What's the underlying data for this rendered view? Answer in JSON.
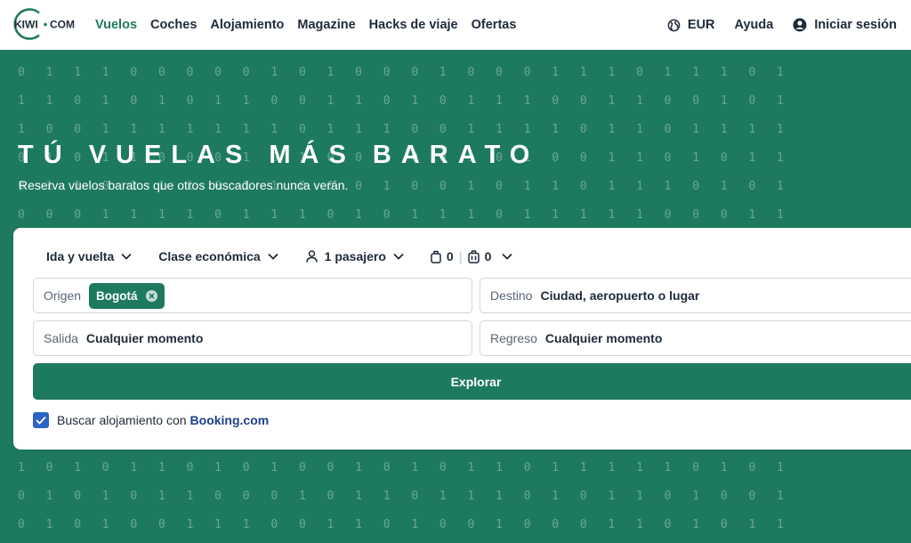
{
  "brand": {
    "logo_text_left": "KIWI",
    "logo_text_right": "COM",
    "accent": "#1e7a5f"
  },
  "nav": {
    "links": [
      {
        "label": "Vuelos",
        "active": true
      },
      {
        "label": "Coches",
        "active": false
      },
      {
        "label": "Alojamiento",
        "active": false
      },
      {
        "label": "Magazine",
        "active": false
      },
      {
        "label": "Hacks de viaje",
        "active": false
      },
      {
        "label": "Ofertas",
        "active": false
      }
    ],
    "currency": "EUR",
    "help": "Ayuda",
    "login": "Iniciar sesión"
  },
  "hero": {
    "title": "TÚ VUELAS MÁS BARATO",
    "subtitle": "Reserva vuelos baratos que otros buscadores nunca verán.",
    "binary_rows": [
      "0111000001010001000111011101",
      "1101010110011010111001100101",
      "1001111111011100111101101111",
      "0101100010100100101001101011",
      "0110111011000100101101110101",
      "0001111011101011101111100011",
      "1010110101001010110111110101",
      "0101011000101101110101101001",
      "0101001110011010010001101011"
    ]
  },
  "search": {
    "trip_type": "Ida y vuelta",
    "cabin_class": "Clase económica",
    "passengers": "1 pasajero",
    "cabin_bags": "0",
    "checked_bags": "0",
    "origin_label": "Origen",
    "origin_value": "Bogotá",
    "destination_label": "Destino",
    "destination_placeholder": "Ciudad, aeropuerto o lugar",
    "departure_label": "Salida",
    "departure_value": "Cualquier momento",
    "return_label": "Regreso",
    "return_value": "Cualquier momento",
    "explore_button": "Explorar",
    "accommodation_text": "Buscar alojamiento con",
    "accommodation_brand": "Booking.com",
    "accommodation_checked": true
  }
}
